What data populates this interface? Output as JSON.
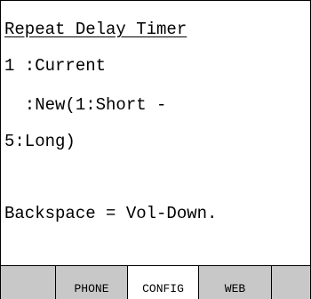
{
  "screen": {
    "title": "Repeat Delay Timer",
    "lines": [
      "1 :Current",
      "  :New(1:Short -",
      "5:Long)",
      "Backspace = Vol-Down."
    ]
  },
  "tabs": {
    "left": "",
    "phone": "PHONE",
    "config": "CONFIG",
    "web": "WEB",
    "right": ""
  },
  "colors": {
    "tab_inactive": "#c8c8c8",
    "tab_active": "#ffffff",
    "text": "#000000"
  }
}
